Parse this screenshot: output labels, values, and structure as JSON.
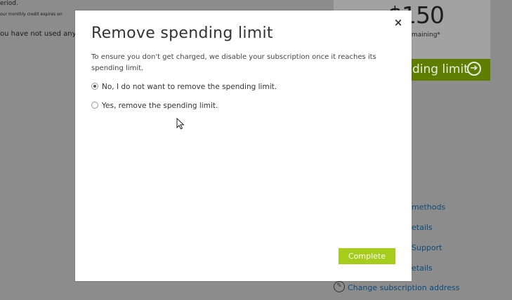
{
  "background": {
    "line1": "eriod.",
    "line2": "our monthly credit expires on",
    "line3": "ou have not used any",
    "underscore": "_"
  },
  "credit": {
    "amount": "$150",
    "remaining": "maining*",
    "spending_limit_label": "ding limit"
  },
  "side_links": [
    "methods",
    "etails",
    "Support",
    "etails",
    "Change subscription address"
  ],
  "modal": {
    "title": "Remove spending limit",
    "description": "To ensure you don't get charged, we disable your subscription once it reaches its spending limit.",
    "options": [
      {
        "label": "No, I do not want to remove the spending limit.",
        "selected": true
      },
      {
        "label": "Yes, remove the spending limit.",
        "selected": false
      }
    ],
    "complete_label": "Complete",
    "close_glyph": "×"
  },
  "colors": {
    "accent_green": "#a6cc1c",
    "link_blue": "#0a4b7a"
  }
}
